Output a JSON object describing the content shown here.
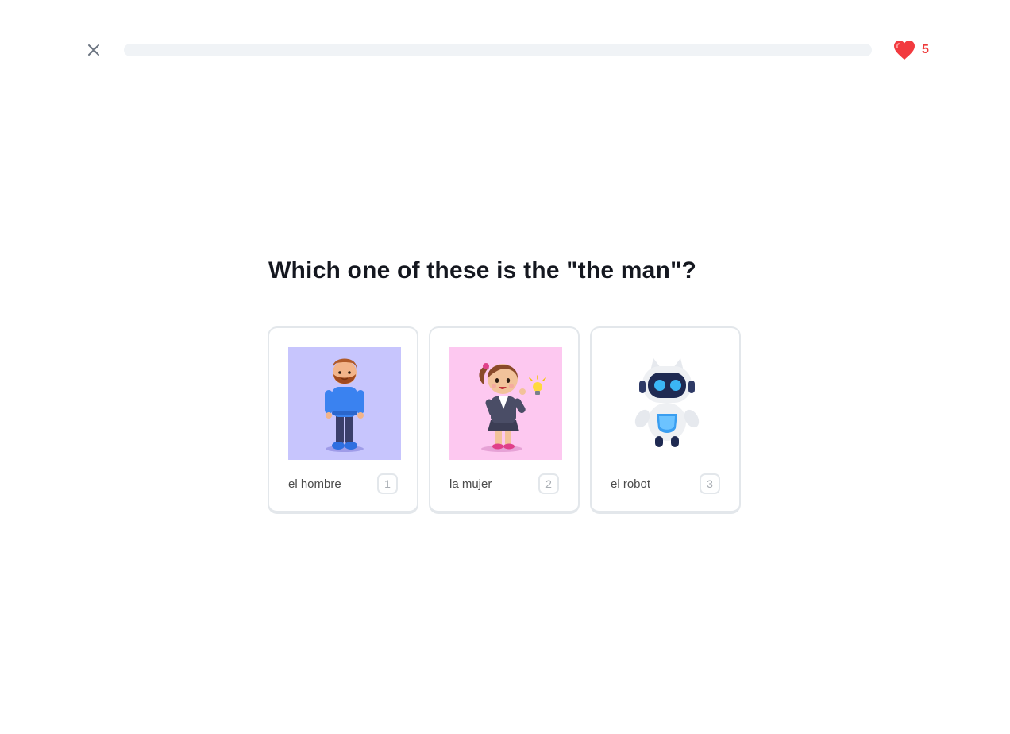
{
  "header": {
    "close_icon": "close-icon",
    "progress": 0,
    "progress_color": "#58cc02",
    "hearts_icon": "heart-icon",
    "hearts_count": "5",
    "hearts_color": "#ee3a3a"
  },
  "question": "Which one of these is the \"the man\"?",
  "options": [
    {
      "label": "el hombre",
      "key": "1",
      "image": "man-illustration",
      "bg": "#c7c5fd"
    },
    {
      "label": "la mujer",
      "key": "2",
      "image": "woman-illustration",
      "bg": "#fdc8f0"
    },
    {
      "label": "el robot",
      "key": "3",
      "image": "robot-illustration",
      "bg": "#ffffff"
    }
  ]
}
